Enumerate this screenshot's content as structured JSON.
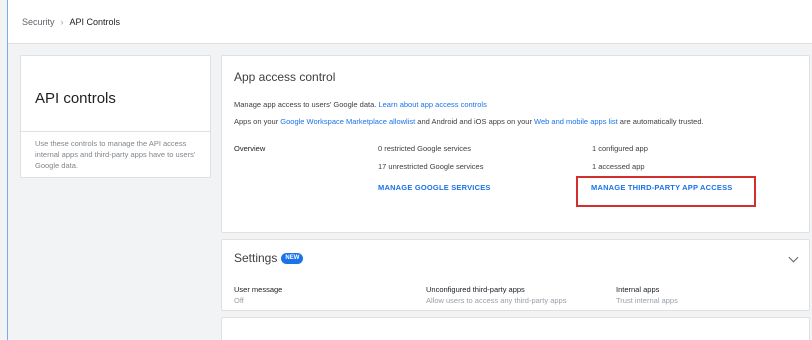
{
  "breadcrumb": {
    "parent": "Security",
    "separator": "›",
    "current": "API Controls"
  },
  "sidebar": {
    "title": "API controls",
    "description": "Use these controls to manage the API access internal apps and third-party apps have to users' Google data."
  },
  "access_card": {
    "title": "App access control",
    "line1_prefix": "Manage app access to users' Google data. ",
    "line1_link": "Learn about app access controls",
    "line2_a": "Apps on your ",
    "line2_link1": "Google Workspace Marketplace allowlist",
    "line2_b": " and Android and iOS apps on your ",
    "line2_link2": "Web and mobile apps list",
    "line2_c": " are automatically trusted.",
    "overview_label": "Overview",
    "restricted": "0 restricted Google services",
    "unrestricted": "17 unrestricted Google services",
    "configured": "1 configured app",
    "accessed": "1 accessed app",
    "manage_google": "MANAGE GOOGLE SERVICES",
    "manage_third": "MANAGE THIRD-PARTY APP ACCESS"
  },
  "settings_card": {
    "title": "Settings",
    "badge": "NEW",
    "items": [
      {
        "label": "User message",
        "value": "Off"
      },
      {
        "label": "Unconfigured third-party apps",
        "value": "Allow users to access any third-party apps"
      },
      {
        "label": "Internal apps",
        "value": "Trust internal apps"
      }
    ]
  },
  "colors": {
    "link": "#1a73e8",
    "highlight": "#d32f2f"
  }
}
